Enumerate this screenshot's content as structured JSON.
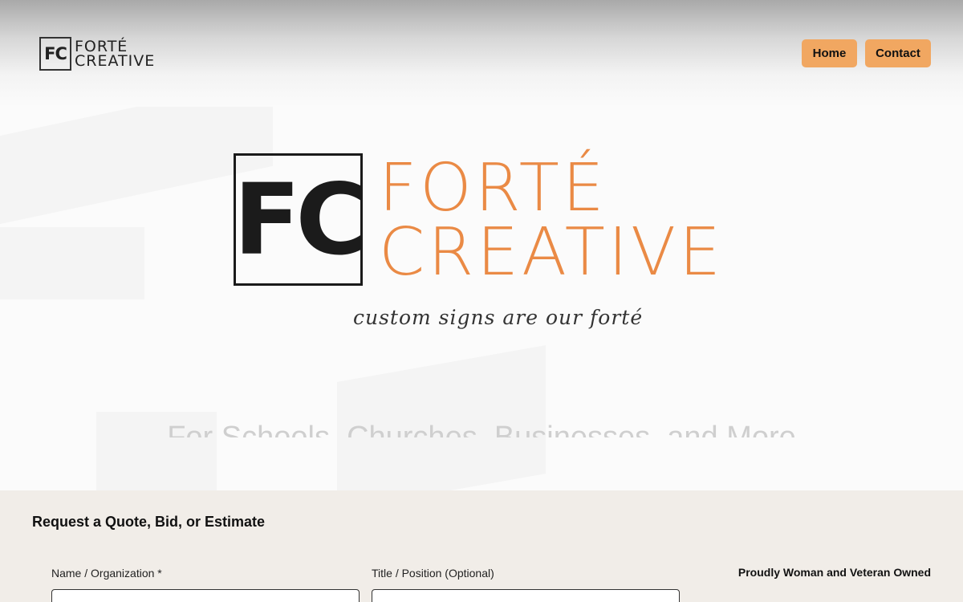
{
  "header": {
    "logo_monogram": "FC",
    "logo_line1": "FORTÉ",
    "logo_line2": "CREATIVE",
    "nav": [
      {
        "label": "Home"
      },
      {
        "label": "Contact"
      }
    ]
  },
  "hero": {
    "monogram": "FC",
    "brand_line1": "FORTÉ",
    "brand_line2": "CREATIVE",
    "tagline": "custom signs are our forté",
    "subtitle": "For Schools, Churches, Businesses, and More"
  },
  "quote": {
    "title": "Request a Quote, Bid, or Estimate",
    "name_label": "Name / Organization *",
    "position_label": "Title / Position (Optional)",
    "name_value": "",
    "position_value": "",
    "owned_note": "Proudly Woman and Veteran Owned"
  },
  "colors": {
    "accent": "#f1a761",
    "brand_orange": "#ea8a45",
    "section_bg": "#f1ede8"
  }
}
